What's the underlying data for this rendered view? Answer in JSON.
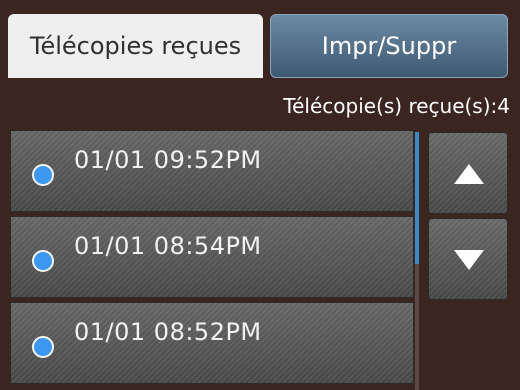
{
  "tabs": {
    "active_label": "Télécopies reçues",
    "button_label": "Impr/Suppr"
  },
  "summary": {
    "received_count": "Télécopie(s) reçue(s):4"
  },
  "fax_list": [
    {
      "label": "01/01 09:52PM",
      "selected": false
    },
    {
      "label": "01/01 08:54PM",
      "selected": false
    },
    {
      "label": "01/01 08:52PM",
      "selected": false
    }
  ],
  "icons": {
    "scroll_up": "triangle-up-icon",
    "scroll_down": "triangle-down-icon",
    "list_marker": "radio-dot-icon"
  },
  "colors": {
    "background": "#3b2520",
    "button_blue": "#4d6b86",
    "dot_blue": "#3c97f0"
  }
}
